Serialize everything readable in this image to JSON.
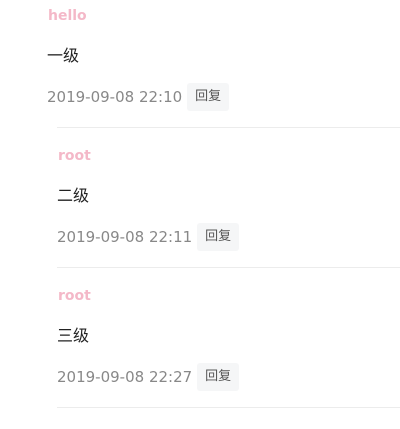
{
  "comments": [
    {
      "author": "hello",
      "text": "一级",
      "time": "2019-09-08 22:10",
      "reply_label": "回复"
    },
    {
      "author": "root",
      "text": "二级",
      "time": "2019-09-08 22:11",
      "reply_label": "回复"
    },
    {
      "author": "root",
      "text": "三级",
      "time": "2019-09-08 22:27",
      "reply_label": "回复"
    }
  ],
  "colors": {
    "author": "#f4b8c8",
    "body_text": "#222222",
    "timestamp": "#888888",
    "reply_bg": "#f5f6f7",
    "divider": "#ececec"
  }
}
